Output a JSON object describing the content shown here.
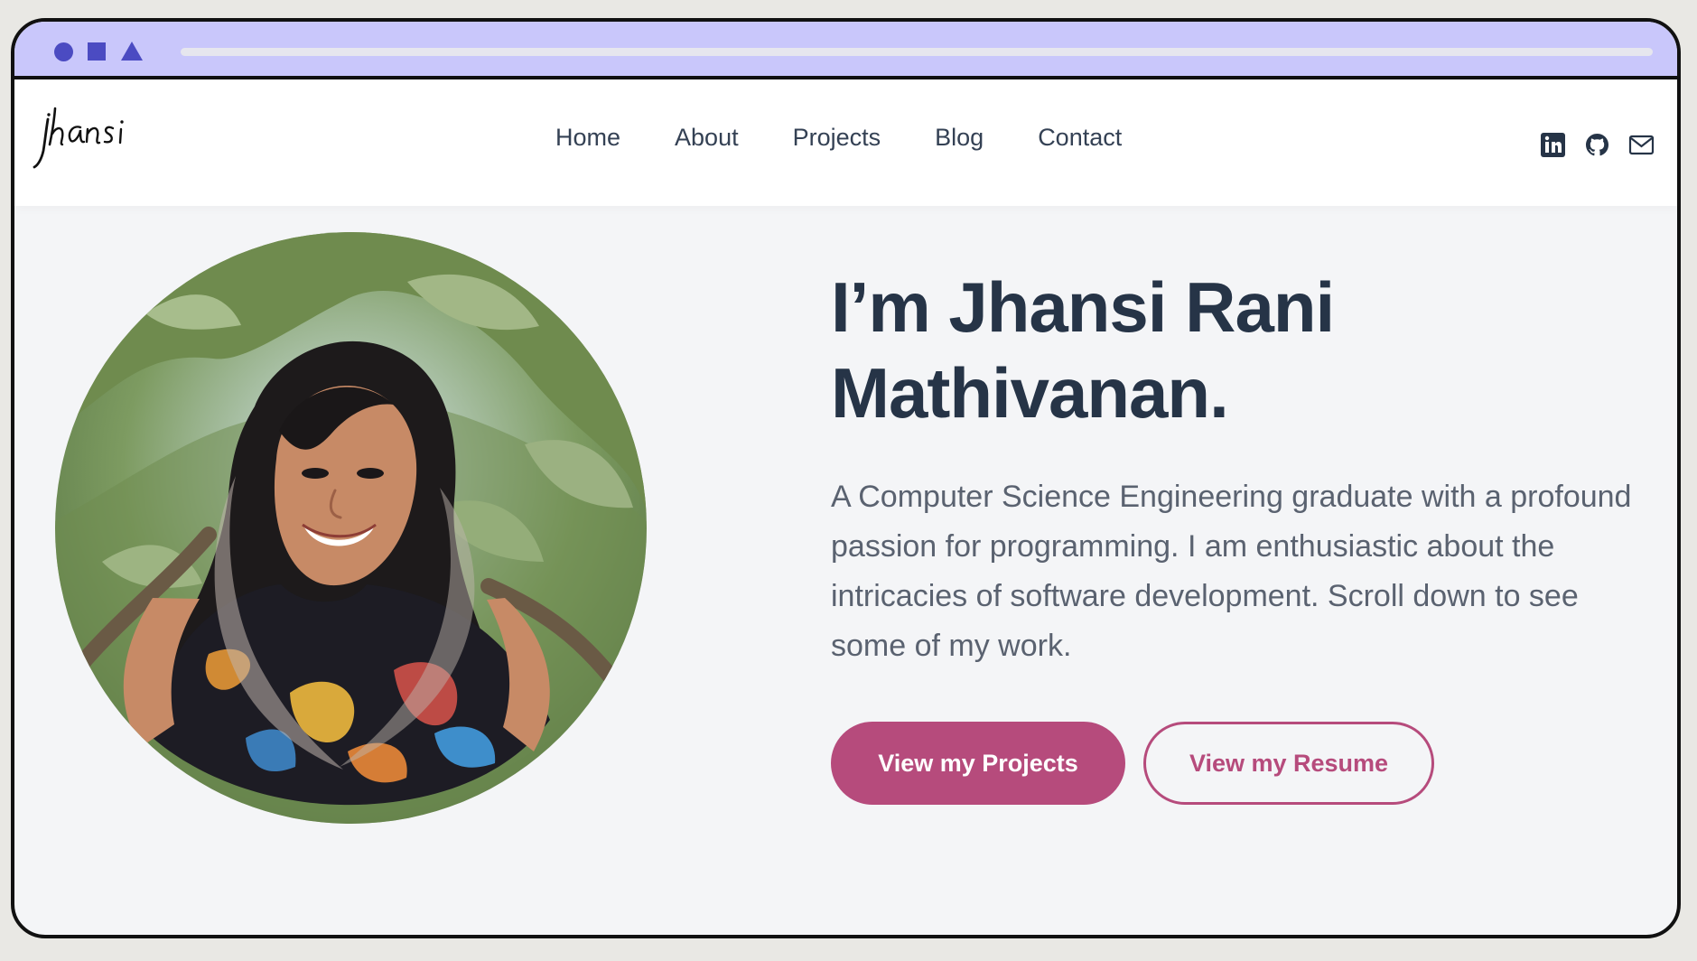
{
  "site": {
    "logo_text": "jhansi"
  },
  "nav": {
    "links": [
      "Home",
      "About",
      "Projects",
      "Blog",
      "Contact"
    ]
  },
  "social": [
    {
      "name": "linkedin-icon"
    },
    {
      "name": "github-icon"
    },
    {
      "name": "mail-icon"
    }
  ],
  "hero": {
    "title_line1": "I’m Jhansi Rani",
    "title_line2": "Mathivanan.",
    "description": "A Computer Science Engineering graduate with a profound passion for programming. I am enthusiastic about the intricacies of software development. Scroll down to see some of my work.",
    "primary_button": "View my Projects",
    "secondary_button": "View my Resume"
  },
  "colors": {
    "accent": "#b64b7c",
    "text_dark": "#263447",
    "chrome": "#c9c7fb"
  }
}
